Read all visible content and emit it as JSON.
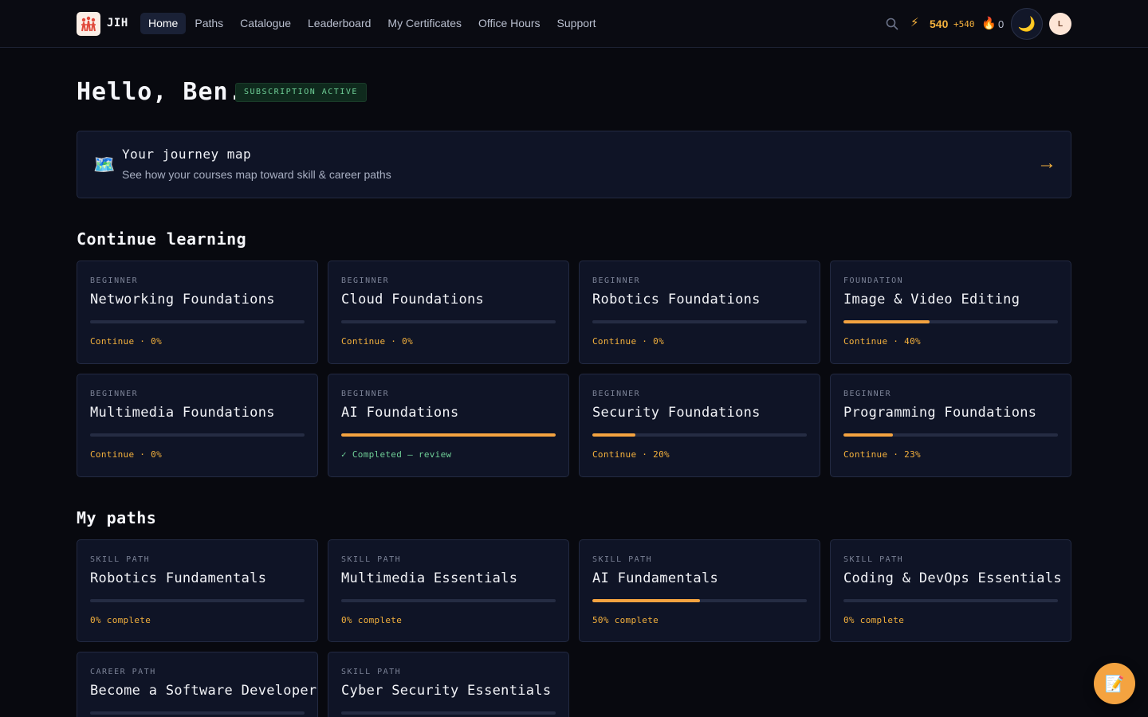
{
  "brand": {
    "name": "JIH"
  },
  "nav": [
    "Home",
    "Paths",
    "Catalogue",
    "Leaderboard",
    "My Certificates",
    "Office Hours",
    "Support"
  ],
  "stats": {
    "xp": "540",
    "xp_delta": "+540",
    "streak": "0"
  },
  "user": {
    "initial": "L",
    "greeting": "Hello, Ben.",
    "subscription": "SUBSCRIPTION ACTIVE"
  },
  "journey": {
    "title": "Your journey map",
    "subtitle": "See how your courses map toward skill & career paths",
    "arrow": "→"
  },
  "sections": {
    "continue": "Continue learning",
    "paths": "My paths"
  },
  "courses": [
    {
      "level": "BEGINNER",
      "title": "Networking Foundations",
      "progress": 0,
      "status": "Continue · 0%"
    },
    {
      "level": "BEGINNER",
      "title": "Cloud Foundations",
      "progress": 0,
      "status": "Continue · 0%"
    },
    {
      "level": "BEGINNER",
      "title": "Robotics Foundations",
      "progress": 0,
      "status": "Continue · 0%"
    },
    {
      "level": "FOUNDATION",
      "title": "Image & Video Editing",
      "progress": 40,
      "status": "Continue · 40%"
    },
    {
      "level": "BEGINNER",
      "title": "Multimedia Foundations",
      "progress": 0,
      "status": "Continue · 0%"
    },
    {
      "level": "BEGINNER",
      "title": "AI Foundations",
      "progress": 100,
      "status": "✓ Completed — review",
      "completed": true
    },
    {
      "level": "BEGINNER",
      "title": "Security Foundations",
      "progress": 20,
      "status": "Continue · 20%"
    },
    {
      "level": "BEGINNER",
      "title": "Programming Foundations",
      "progress": 23,
      "status": "Continue · 23%"
    }
  ],
  "paths": [
    {
      "kind": "SKILL PATH",
      "title": "Robotics Fundamentals",
      "progress": 0,
      "status": "0% complete"
    },
    {
      "kind": "SKILL PATH",
      "title": "Multimedia Essentials",
      "progress": 0,
      "status": "0% complete"
    },
    {
      "kind": "SKILL PATH",
      "title": "AI Fundamentals",
      "progress": 50,
      "status": "50% complete"
    },
    {
      "kind": "SKILL PATH",
      "title": "Coding & DevOps Essentials",
      "progress": 0,
      "status": "0% complete"
    },
    {
      "kind": "CAREER PATH",
      "title": "Become a Software Developer",
      "progress": 0,
      "status": ""
    },
    {
      "kind": "SKILL PATH",
      "title": "Cyber Security Essentials",
      "progress": 0,
      "status": ""
    }
  ]
}
